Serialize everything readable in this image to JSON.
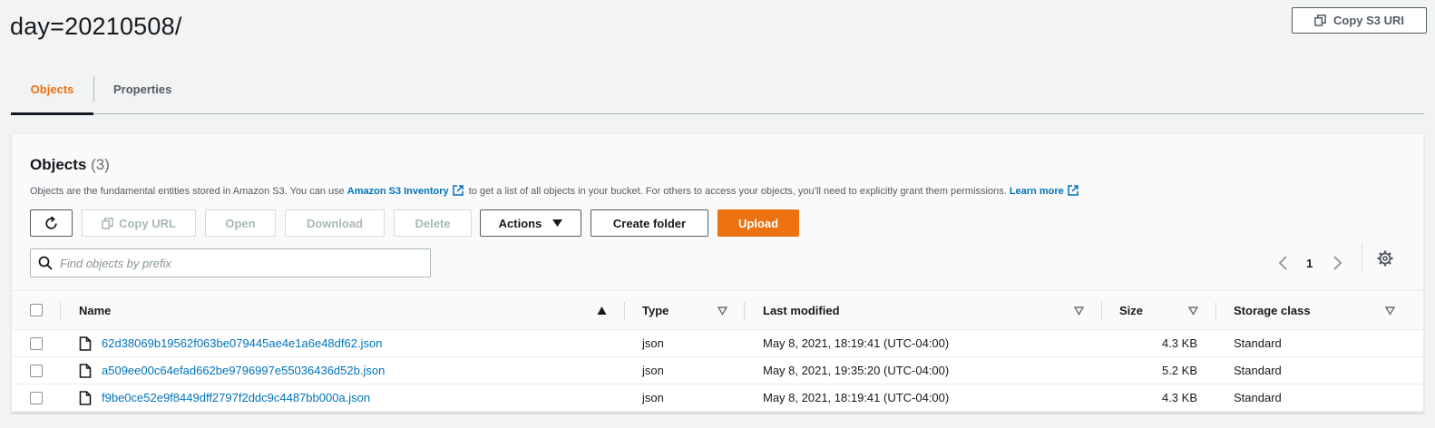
{
  "header": {
    "title": "day=20210508/",
    "copy_uri_label": "Copy S3 URI"
  },
  "tabs": [
    {
      "label": "Objects",
      "active": true
    },
    {
      "label": "Properties",
      "active": false
    }
  ],
  "panel": {
    "title": "Objects",
    "count": "(3)",
    "description": {
      "part1": "Objects are the fundamental entities stored in Amazon S3. You can use ",
      "link1": "Amazon S3 Inventory",
      "part2": " to get a list of all objects in your bucket. For others to access your objects, you’ll need to explicitly grant them permissions. ",
      "link2": "Learn more"
    }
  },
  "toolbar": {
    "copy_url": "Copy URL",
    "open": "Open",
    "download": "Download",
    "delete": "Delete",
    "actions": "Actions",
    "create_folder": "Create folder",
    "upload": "Upload"
  },
  "search": {
    "placeholder": "Find objects by prefix",
    "value": ""
  },
  "pagination": {
    "current_page": "1"
  },
  "table": {
    "columns": {
      "name": "Name",
      "type": "Type",
      "last_modified": "Last modified",
      "size": "Size",
      "storage_class": "Storage class"
    },
    "rows": [
      {
        "name": "62d38069b19562f063be079445ae4e1a6e48df62.json",
        "type": "json",
        "last_modified": "May 8, 2021, 18:19:41 (UTC-04:00)",
        "size": "4.3 KB",
        "storage_class": "Standard"
      },
      {
        "name": "a509ee00c64efad662be9796997e55036436d52b.json",
        "type": "json",
        "last_modified": "May 8, 2021, 19:35:20 (UTC-04:00)",
        "size": "5.2 KB",
        "storage_class": "Standard"
      },
      {
        "name": "f9be0ce52e9f8449dff2797f2ddc9c4487bb000a.json",
        "type": "json",
        "last_modified": "May 8, 2021, 18:19:41 (UTC-04:00)",
        "size": "4.3 KB",
        "storage_class": "Standard"
      }
    ]
  },
  "colors": {
    "accent": "#ec7211",
    "link": "#0073bb",
    "text": "#16191f",
    "muted": "#545b64"
  },
  "icons": [
    "copy-icon",
    "external-link-icon",
    "refresh-icon",
    "caret-down-icon",
    "search-icon",
    "chevron-left-icon",
    "chevron-right-icon",
    "gear-icon",
    "sort-asc-icon",
    "sort-icon",
    "file-icon"
  ]
}
